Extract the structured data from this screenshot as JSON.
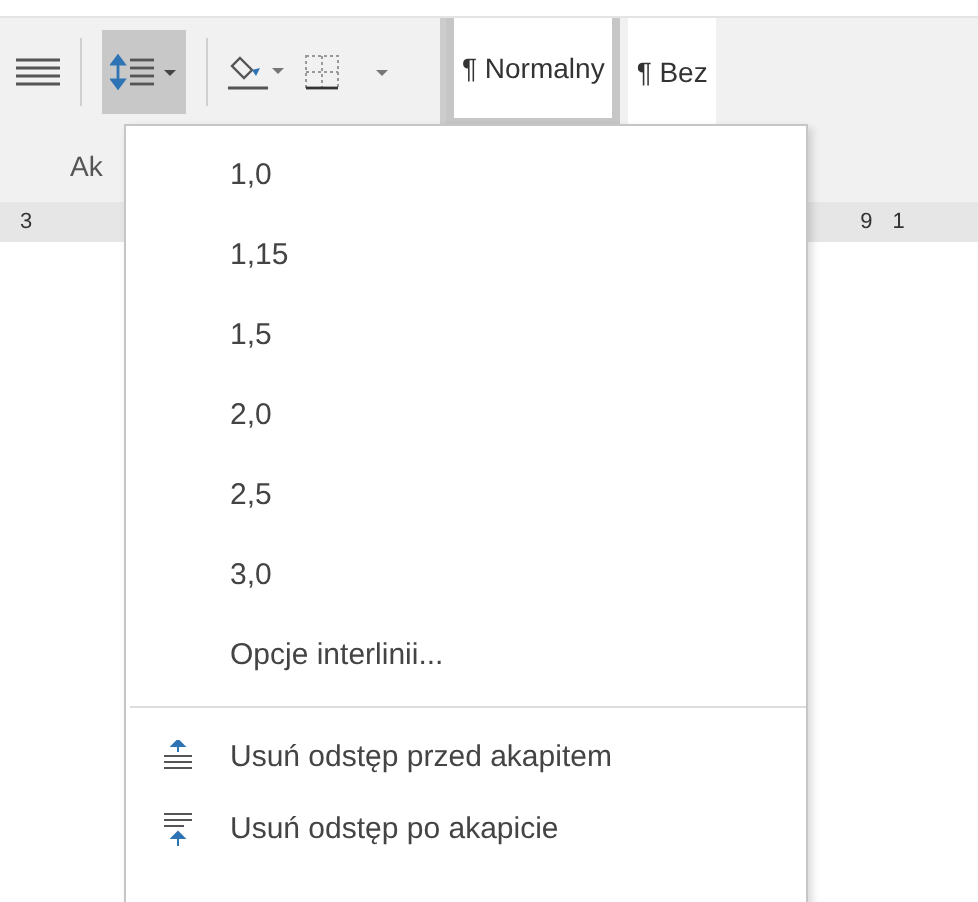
{
  "ribbon": {
    "group_label": "Ak",
    "line_spacing_button": {
      "selected": true
    },
    "styles": [
      {
        "mark": "¶",
        "label": "Normalny",
        "selected": true
      },
      {
        "mark": "¶",
        "label": "Bez",
        "selected": false
      }
    ]
  },
  "ruler": {
    "numbers": [
      "3",
      "9",
      "1"
    ]
  },
  "menu": {
    "items": [
      {
        "kind": "value",
        "label": "1,0"
      },
      {
        "kind": "value",
        "label": "1,15"
      },
      {
        "kind": "value",
        "label": "1,5"
      },
      {
        "kind": "value",
        "label": "2,0"
      },
      {
        "kind": "value",
        "label": "2,5"
      },
      {
        "kind": "value",
        "label": "3,0"
      },
      {
        "kind": "value",
        "label": "Opcje interlinii..."
      },
      {
        "kind": "before",
        "label": "Usuń odstęp przed akapitem"
      },
      {
        "kind": "after",
        "label": "Usuń odstęp po akapicie"
      }
    ]
  }
}
